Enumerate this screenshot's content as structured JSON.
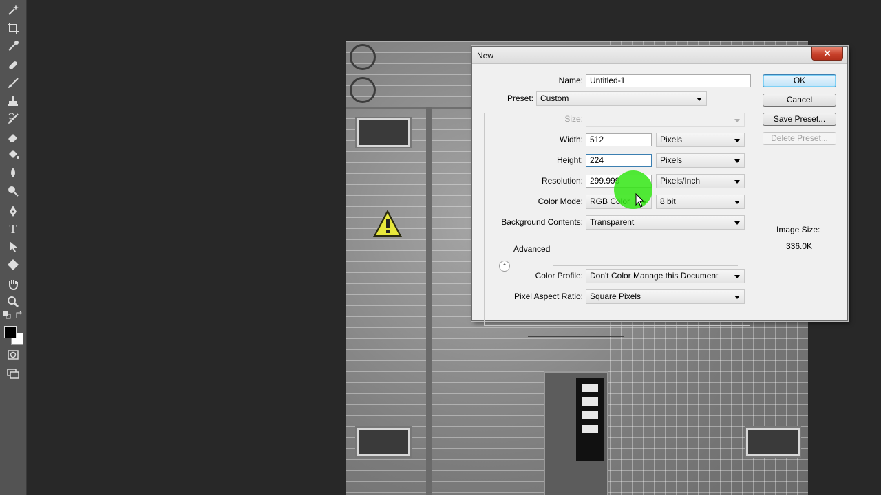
{
  "dialog": {
    "title": "New",
    "close_label": "✕",
    "name": {
      "label": "Name:",
      "value": "Untitled-1"
    },
    "preset": {
      "label": "Preset:",
      "value": "Custom"
    },
    "size": {
      "label": "Size:",
      "value": ""
    },
    "width": {
      "label": "Width:",
      "value": "512",
      "unit": "Pixels"
    },
    "height": {
      "label": "Height:",
      "value": "224",
      "unit": "Pixels"
    },
    "resolution": {
      "label": "Resolution:",
      "value": "299.999",
      "unit": "Pixels/Inch"
    },
    "color_mode": {
      "label": "Color Mode:",
      "value": "RGB Color",
      "depth": "8 bit"
    },
    "background": {
      "label": "Background Contents:",
      "value": "Transparent"
    },
    "advanced": {
      "label": "Advanced"
    },
    "color_profile": {
      "label": "Color Profile:",
      "value": "Don't Color Manage this Document"
    },
    "pixel_aspect": {
      "label": "Pixel Aspect Ratio:",
      "value": "Square Pixels"
    },
    "buttons": {
      "ok": "OK",
      "cancel": "Cancel",
      "save_preset": "Save Preset...",
      "delete_preset": "Delete Preset..."
    },
    "image_size": {
      "label": "Image Size:",
      "value": "336.0K"
    }
  },
  "toolbar": {
    "tools": [
      "magic-wand-icon",
      "crop-icon",
      "eyedropper-icon",
      "healing-brush-icon",
      "brush-icon",
      "clone-stamp-icon",
      "history-brush-icon",
      "eraser-icon",
      "paint-bucket-icon",
      "blur-icon",
      "dodge-icon",
      "pen-icon",
      "type-icon",
      "path-selection-icon",
      "shape-icon",
      "hand-icon",
      "zoom-icon"
    ],
    "type_glyph": "T"
  },
  "colors": {
    "accent": "#3c7fb1",
    "highlight": "#32e614",
    "close": "#c7402a"
  }
}
